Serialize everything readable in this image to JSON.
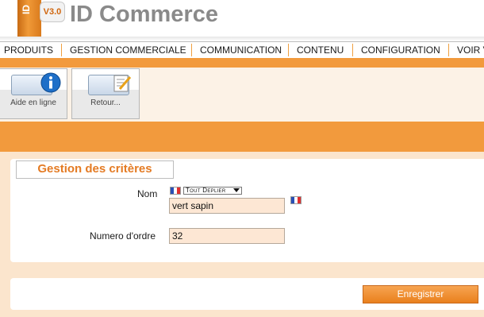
{
  "app": {
    "title": "ID Commerce",
    "version": "V3.0",
    "logo_text": "ID"
  },
  "menu": {
    "items": [
      {
        "label": "PRODUITS"
      },
      {
        "label": "GESTION COMMERCIALE"
      },
      {
        "label": "COMMUNICATION"
      },
      {
        "label": "CONTENU"
      },
      {
        "label": "CONFIGURATION"
      },
      {
        "label": "VOIR V"
      }
    ]
  },
  "toolbar": {
    "help_label": "Aide en ligne",
    "help_icon": "info-icon",
    "back_label": "Retour...",
    "back_icon": "edit-document-icon"
  },
  "form": {
    "title": "Gestion des critères",
    "name_label": "Nom",
    "name_value": "vert sapin",
    "unfold_label": "Tout Deplier",
    "order_label": "Numero d'ordre",
    "order_value": "32"
  },
  "actions": {
    "save_label": "Enregistrer"
  },
  "colors": {
    "accent": "#f29a3d",
    "title": "#e47b24",
    "field_bg": "#fde7d4"
  }
}
